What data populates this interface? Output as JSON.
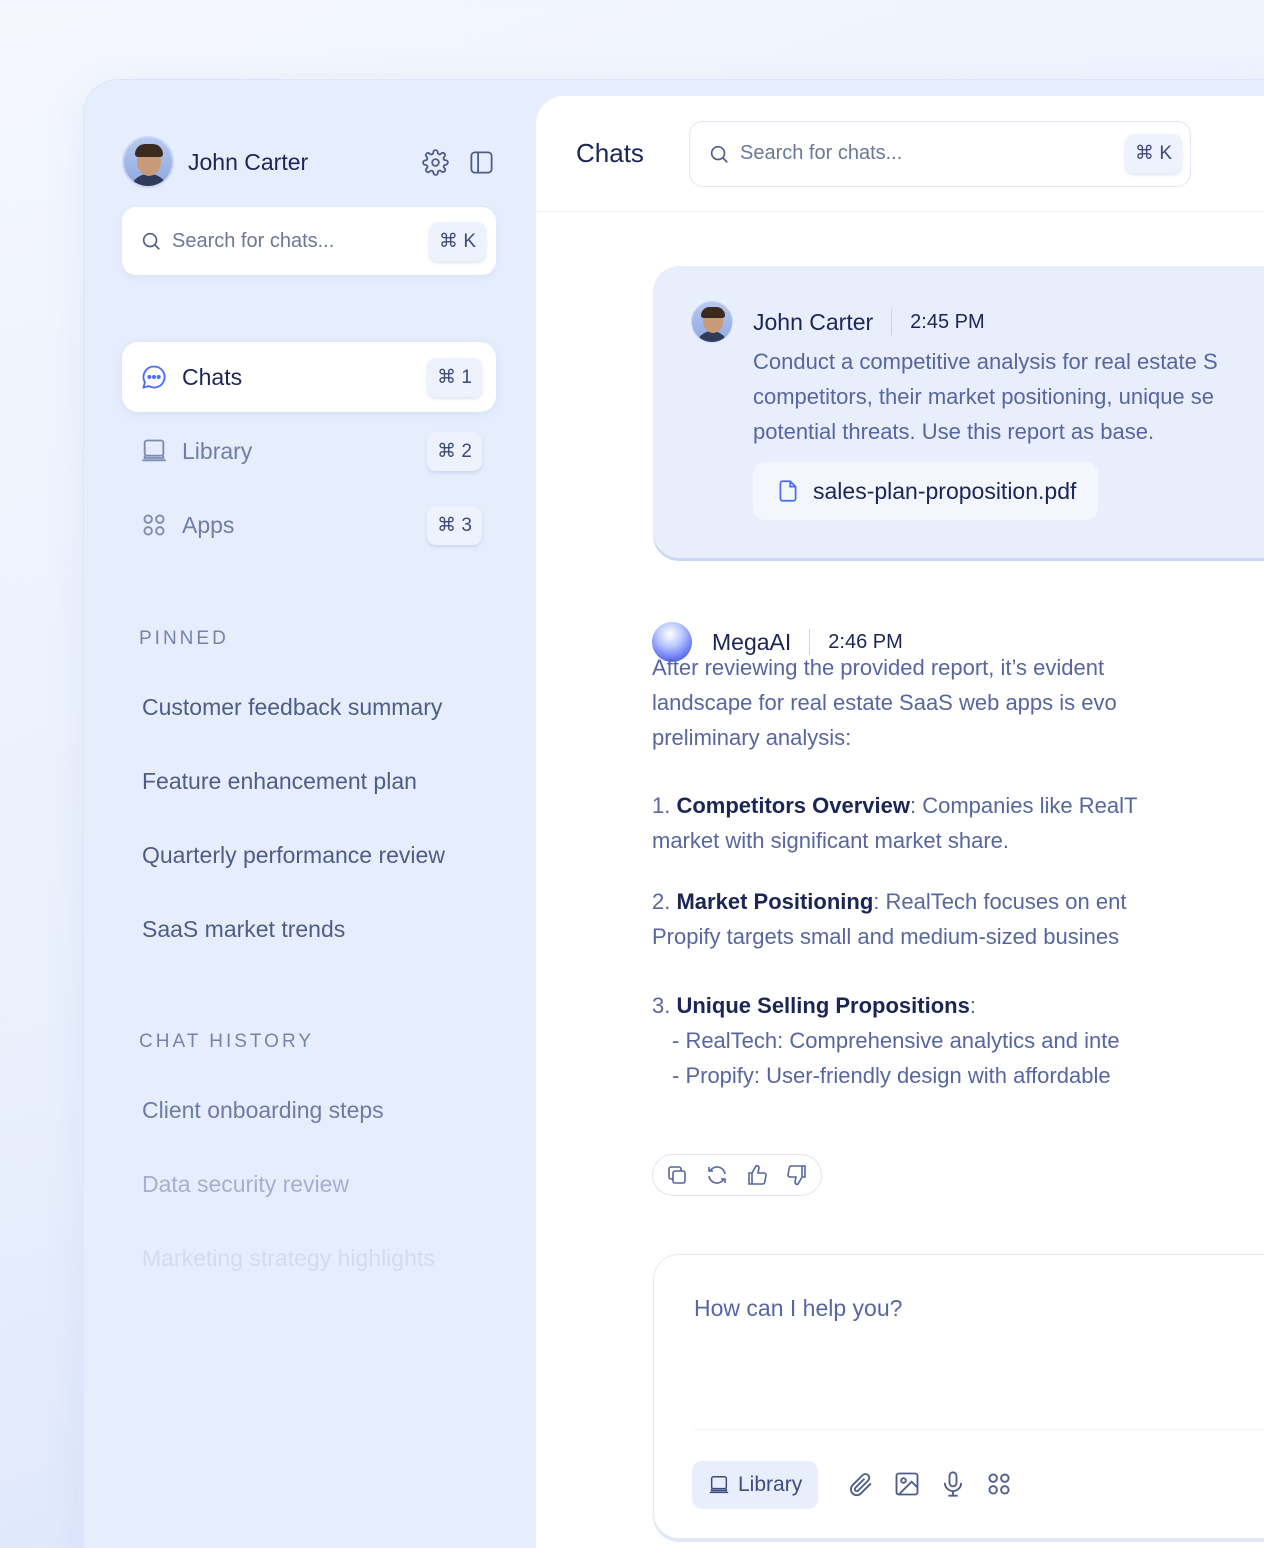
{
  "user": {
    "name": "John Carter"
  },
  "sidebar": {
    "search": {
      "placeholder": "Search for chats...",
      "shortcut": "⌘ K"
    },
    "nav": [
      {
        "label": "Chats",
        "shortcut": "⌘ 1",
        "icon": "chat-bubble-icon",
        "active": true
      },
      {
        "label": "Library",
        "shortcut": "⌘ 2",
        "icon": "laptop-icon"
      },
      {
        "label": "Apps",
        "shortcut": "⌘ 3",
        "icon": "apps-grid-icon"
      }
    ],
    "pinned_title": "PINNED",
    "pinned": [
      "Customer feedback summary",
      "Feature enhancement plan",
      "Quarterly performance review",
      "SaaS market trends"
    ],
    "history_title": "CHAT HISTORY",
    "history": [
      "Client onboarding steps",
      "Data security review",
      "Marketing strategy highlights"
    ]
  },
  "main": {
    "title": "Chats",
    "search": {
      "placeholder": "Search for chats...",
      "shortcut": "⌘ K"
    }
  },
  "messages": {
    "user": {
      "name": "John Carter",
      "time": "2:45 PM",
      "lines": [
        "Conduct a competitive analysis for real estate S",
        "competitors, their market positioning, unique se",
        "potential threats. Use this report as base."
      ],
      "attachment": "sales-plan-proposition.pdf"
    },
    "ai": {
      "name": "MegaAI",
      "time": "2:46 PM",
      "intro": [
        "After reviewing the provided report, it’s evident",
        "landscape for real estate SaaS web apps is evo",
        "preliminary analysis:"
      ],
      "points": [
        {
          "num": "1.",
          "title": "Competitors Overview",
          "rest": ": Companies like RealT",
          "line2": "market with significant market share."
        },
        {
          "num": "2.",
          "title": "Market Positioning",
          "rest": ": RealTech focuses on ent",
          "line2": "Propify targets small and medium-sized busines"
        },
        {
          "num": "3.",
          "title": "Unique Selling Propositions",
          "rest": ":",
          "sub": [
            "- RealTech: Comprehensive analytics and inte",
            "- Propify: User-friendly design with affordable"
          ]
        }
      ]
    }
  },
  "composer": {
    "placeholder": "How can I help you?",
    "library_label": "Library"
  },
  "colors": {
    "primary_text": "#1b2556",
    "muted_text": "#5766a0",
    "accent": "#4a6cf7",
    "sidebar_bg": "#e6edfc"
  }
}
